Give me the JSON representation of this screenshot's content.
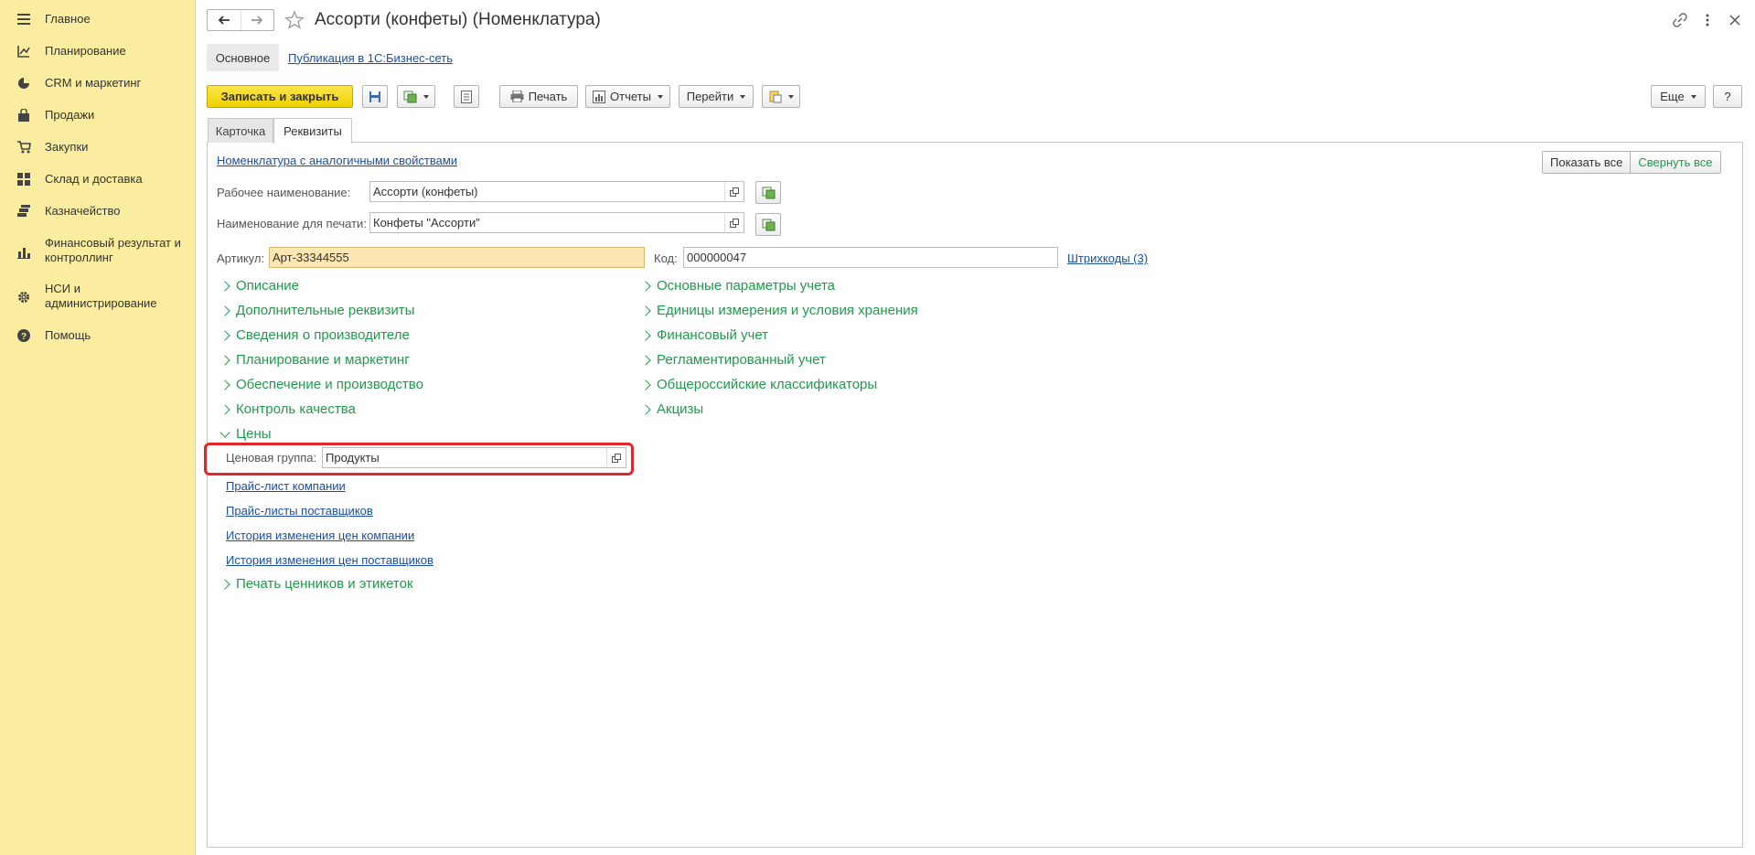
{
  "sidebar": {
    "items": [
      {
        "label": "Главное",
        "icon": "menu-icon"
      },
      {
        "label": "Планирование",
        "icon": "planning-icon"
      },
      {
        "label": "CRM и маркетинг",
        "icon": "pie-chart-icon"
      },
      {
        "label": "Продажи",
        "icon": "bag-icon"
      },
      {
        "label": "Закупки",
        "icon": "cart-icon"
      },
      {
        "label": "Склад и доставка",
        "icon": "warehouse-icon"
      },
      {
        "label": "Казначейство",
        "icon": "treasury-icon"
      },
      {
        "label": "Финансовый результат и контроллинг",
        "icon": "bar-chart-icon"
      },
      {
        "label": "НСИ и администрирование",
        "icon": "gear-icon"
      },
      {
        "label": "Помощь",
        "icon": "help-icon"
      }
    ]
  },
  "header": {
    "title": "Ассорти (конфеты) (Номенклатура)"
  },
  "subtabs": {
    "main": "Основное",
    "publish": "Публикация в 1С:Бизнес-сеть"
  },
  "toolbar": {
    "save_close": "Записать и закрыть",
    "print": "Печать",
    "reports": "Отчеты",
    "goto": "Перейти",
    "more": "Еще",
    "help": "?"
  },
  "form_tabs": {
    "card": "Карточка",
    "details": "Реквизиты"
  },
  "form": {
    "similar_link": "Номенклатура с аналогичными свойствами",
    "show_all": "Показать все",
    "collapse_all": "Свернуть все",
    "work_name_label": "Рабочее наименование:",
    "work_name_value": "Ассорти (конфеты)",
    "print_name_label": "Наименование для печати:",
    "print_name_value": "Конфеты \"Ассорти\"",
    "article_label": "Артикул:",
    "article_value": "Арт-33344555",
    "code_label": "Код:",
    "code_value": "000000047",
    "barcodes_link": "Штрихкоды (3)"
  },
  "groups_left": [
    "Описание",
    "Дополнительные реквизиты",
    "Сведения о производителе",
    "Планирование и маркетинг",
    "Обеспечение и производство",
    "Контроль качества"
  ],
  "groups_right": [
    "Основные параметры учета",
    "Единицы измерения и условия хранения",
    "Финансовый учет",
    "Регламентированный учет",
    "Общероссийские классификаторы",
    "Акцизы"
  ],
  "prices": {
    "title": "Цены",
    "price_group_label": "Ценовая группа:",
    "price_group_value": "Продукты",
    "links": [
      "Прайс-лист компании",
      "Прайс-листы поставщиков",
      "История изменения цен компании",
      "История изменения цен поставщиков"
    ]
  },
  "labels_group": "Печать ценников и этикеток",
  "colors": {
    "sidebar_bg": "#fbeda0",
    "group_green": "#1f9a4a",
    "link_blue": "#1a4ea6",
    "highlight_red": "#e2262a",
    "primary_yellow": "#f0d000"
  }
}
